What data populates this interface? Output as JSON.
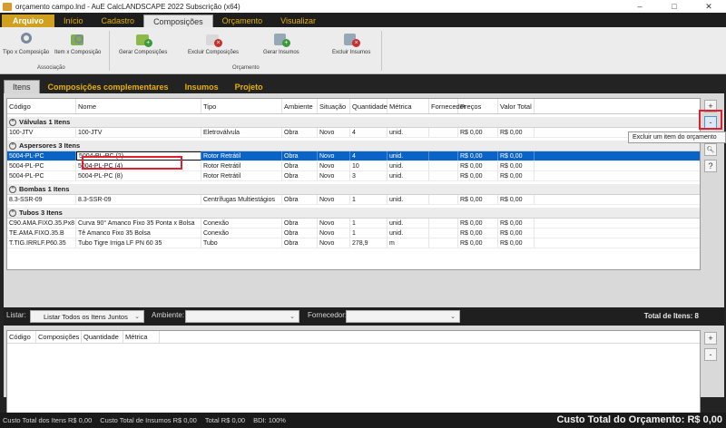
{
  "window": {
    "title": "orçamento campo.lnd - AuE CalcLANDSCAPE 2022 Subscrição (x64)",
    "controls": [
      "–",
      "□",
      "✕"
    ]
  },
  "menu": {
    "tabs": [
      "Arquivo",
      "Início",
      "Cadastro",
      "Composições",
      "Orçamento",
      "Visualizar"
    ],
    "active": "Composições"
  },
  "ribbon": {
    "buttons": [
      {
        "label": "Tipo x Composição",
        "icon": "tools-gear-icon"
      },
      {
        "label": "Item x Composição",
        "icon": "item-gear-icon"
      },
      {
        "label": "Gerar Composições",
        "icon": "generate-compositions-icon"
      },
      {
        "label": "Excluir Composições",
        "icon": "delete-compositions-icon"
      },
      {
        "label": "Gerar Insumos",
        "icon": "generate-inputs-icon"
      },
      {
        "label": "Excluir Insumos",
        "icon": "delete-inputs-icon"
      }
    ],
    "groups": [
      "Associação",
      "Orçamento"
    ]
  },
  "subtabs": [
    "Itens",
    "Composições complementares",
    "Insumos",
    "Projeto"
  ],
  "grid": {
    "headers": [
      "Código",
      "Nome",
      "Tipo",
      "Ambiente",
      "Situação",
      "Quantidade",
      "Métrica",
      "Fornecedor",
      "Preços",
      "Valor Total"
    ],
    "groups": [
      {
        "title": "Válvulas  1 Itens",
        "rows": [
          [
            "100-JTV",
            "100-JTV",
            "Eletroválvula",
            "Obra",
            "Novo",
            "4",
            "unid.",
            "",
            "R$ 0,00",
            "R$ 0,00"
          ]
        ]
      },
      {
        "title": "Aspersores  3 Itens",
        "rows": [
          [
            "5004-PL-PC",
            "5004-PL-PC (2)",
            "Rotor Retrátil",
            "Obra",
            "Novo",
            "4",
            "unid.",
            "",
            "R$ 0,00",
            "R$ 0,00"
          ],
          [
            "5004-PL-PC",
            "5004-PL-PC (4)",
            "Rotor Retrátil",
            "Obra",
            "Novo",
            "10",
            "unid.",
            "",
            "R$ 0,00",
            "R$ 0,00"
          ],
          [
            "5004-PL-PC",
            "5004-PL-PC (8)",
            "Rotor Retrátil",
            "Obra",
            "Novo",
            "3",
            "unid.",
            "",
            "R$ 0,00",
            "R$ 0,00"
          ]
        ]
      },
      {
        "title": "Bombas  1 Itens",
        "rows": [
          [
            "8.3-SSR-09",
            "8.3-SSR-09",
            "Centrífugas Multiestágios",
            "Obra",
            "Novo",
            "1",
            "unid.",
            "",
            "R$ 0,00",
            "R$ 0,00"
          ]
        ]
      },
      {
        "title": "Tubos  3 Itens",
        "rows": [
          [
            "C90.AMA.FIXO.35.Px8",
            "Curva 90° Amanco Fixo 35 Ponta x Bolsa",
            "Conexão",
            "Obra",
            "Novo",
            "1",
            "unid.",
            "",
            "R$ 0,00",
            "R$ 0,00"
          ],
          [
            "TE.AMA.FIXO.35.B",
            "Tê Amanco Fixo 35 Bolsa",
            "Conexão",
            "Obra",
            "Novo",
            "1",
            "unid.",
            "",
            "R$ 0,00",
            "R$ 0,00"
          ],
          [
            "T.TIG.IRRLF.P60.35",
            "Tubo Tigre Irriga LF PN 60 35",
            "Tubo",
            "Obra",
            "Novo",
            "278,9",
            "m",
            "",
            "R$ 0,00",
            "R$ 0,00"
          ]
        ]
      }
    ],
    "selected": {
      "group": 1,
      "row": 0
    }
  },
  "side_buttons": [
    "+",
    "-",
    "🔍",
    "?"
  ],
  "tooltip": "Excluir um item do orçamento",
  "filters": {
    "list_label": "Listar:",
    "list_value": "Listar Todos os Itens Juntos",
    "ambiente_label": "Ambiente:",
    "ambiente_value": "",
    "fornecedor_label": "Fornecedor:",
    "fornecedor_value": "",
    "total_items": "Total de Itens: 8"
  },
  "grid2": {
    "headers": [
      "Código",
      "Composições",
      "Quantidade",
      "Métrica"
    ]
  },
  "side_buttons2": [
    "+",
    "-"
  ],
  "status": {
    "items": [
      "Custo Total dos Itens R$ 0,00",
      "Custo Total de Insumos R$ 0,00",
      "Total R$ 0,00",
      "BDI: 100%"
    ],
    "grand_total": "Custo Total do Orçamento: R$ 0,00"
  }
}
